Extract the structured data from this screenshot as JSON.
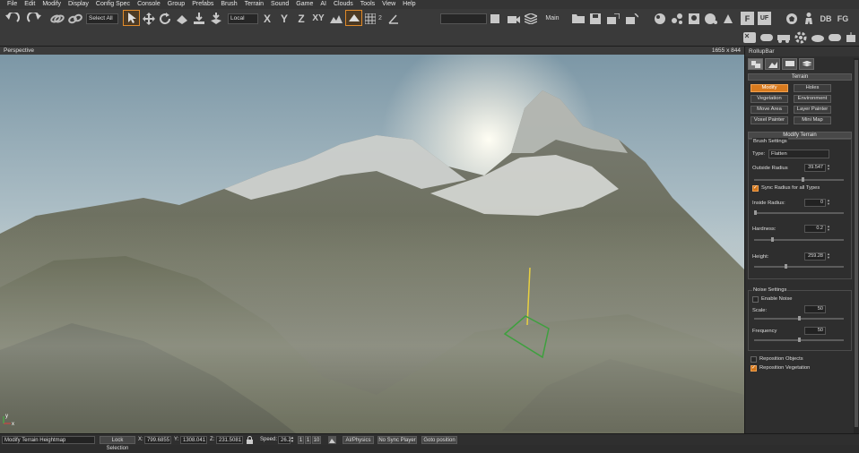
{
  "menu": [
    "File",
    "Edit",
    "Modify",
    "Display",
    "Config Spec",
    "Console",
    "Group",
    "Prefabs",
    "Brush",
    "Terrain",
    "Sound",
    "Game",
    "AI",
    "Clouds",
    "Tools",
    "View",
    "Help"
  ],
  "toolbar": {
    "select_all": "Select All",
    "coord_system": "Local",
    "axis_x": "X",
    "axis_y": "Y",
    "axis_z": "Z",
    "axis_xy": "XY",
    "snap_value": "2",
    "camera_label": "Main",
    "f_label": "F",
    "uf_label": "UF",
    "db_label": "DB",
    "fg_label": "FG"
  },
  "viewport": {
    "title": "Perspective",
    "resolution": "1655 x 844",
    "axis_x": "x",
    "axis_y": "y"
  },
  "rollup": {
    "title": "RollupBar",
    "terrain_header": "Terrain",
    "terrain_buttons": [
      "Modify",
      "Holes",
      "Vegetation",
      "Environment",
      "Move Area",
      "Layer Painter",
      "Voxel Painter",
      "Mini Map"
    ],
    "modify_header": "Modify Terrain",
    "brush_settings": "Brush Settings",
    "type_label": "Type:",
    "type_value": "Flatten",
    "outside_radius_label": "Outside Radius",
    "outside_radius": "39.547",
    "sync_label": "Sync Radius for all Types",
    "inside_radius_label": "Inside Radius:",
    "inside_radius": "0",
    "hardness_label": "Hardness:",
    "hardness": "0.2",
    "height_label": "Height:",
    "height": "259.28",
    "noise_settings": "Noise Settings",
    "enable_noise": "Enable Noise",
    "scale_label": "Scale:",
    "scale": "50",
    "frequency_label": "Frequency",
    "frequency": "50",
    "reposition_objects": "Reposition Objects",
    "reposition_vegetation": "Reposition Vegetation",
    "sliders": {
      "outside_radius": 0.55,
      "inside_radius": 0.0,
      "hardness": 0.2,
      "height": 0.35,
      "scale": 0.5,
      "frequency": 0.5
    }
  },
  "status": {
    "left": "Modify Terrain Heightmap",
    "lock_selection": "Lock Selection",
    "x_label": "X:",
    "x": "799.6855",
    "y_label": "Y:",
    "y": "1308.041",
    "z_label": "Z:",
    "z": "231.5081",
    "speed_label": "Speed:",
    "speed": "26.2",
    "speed_opts": [
      "1",
      "1",
      "10"
    ],
    "ai_physics": "AI/Physics",
    "no_sync_player": "No Sync Player",
    "goto_position": "Goto position"
  },
  "colors": {
    "accent": "#d87a1e",
    "gizmo_yellow": "#e8d040",
    "gizmo_green": "#3ea03e"
  }
}
